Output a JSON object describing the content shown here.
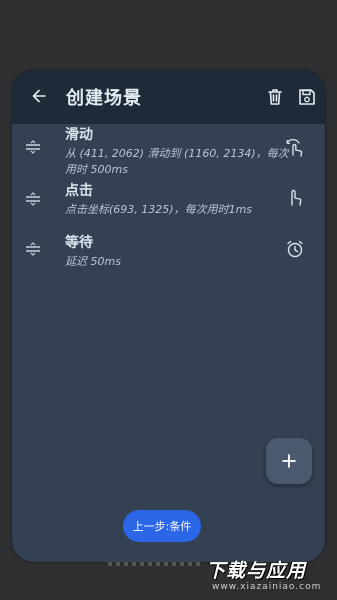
{
  "header": {
    "title": "创建场景",
    "back_icon": "arrow-left-icon",
    "delete_icon": "trash-icon",
    "save_icon": "floppy-save-icon"
  },
  "actions": [
    {
      "name": "滑动",
      "desc": "从 (411, 2062) 滑动到 (1160, 2134)，每次用时 500ms",
      "icon": "swipe-gesture-icon"
    },
    {
      "name": "点击",
      "desc": "点击坐标(693, 1325)，每次用时1ms",
      "icon": "tap-finger-icon"
    },
    {
      "name": "等待",
      "desc": "延迟 50ms",
      "icon": "alarm-clock-icon"
    }
  ],
  "fab": {
    "icon": "plus-icon"
  },
  "footer": {
    "prev_label": "上一步:条件"
  },
  "watermark": {
    "main": "下载与应用",
    "sub": "www.xiazainiao.com"
  },
  "colors": {
    "background": "#2e2f31",
    "card": "#344152",
    "appbar": "#1f2a39",
    "accent_button": "#2b66e6",
    "fab": "#4a5a6e"
  }
}
